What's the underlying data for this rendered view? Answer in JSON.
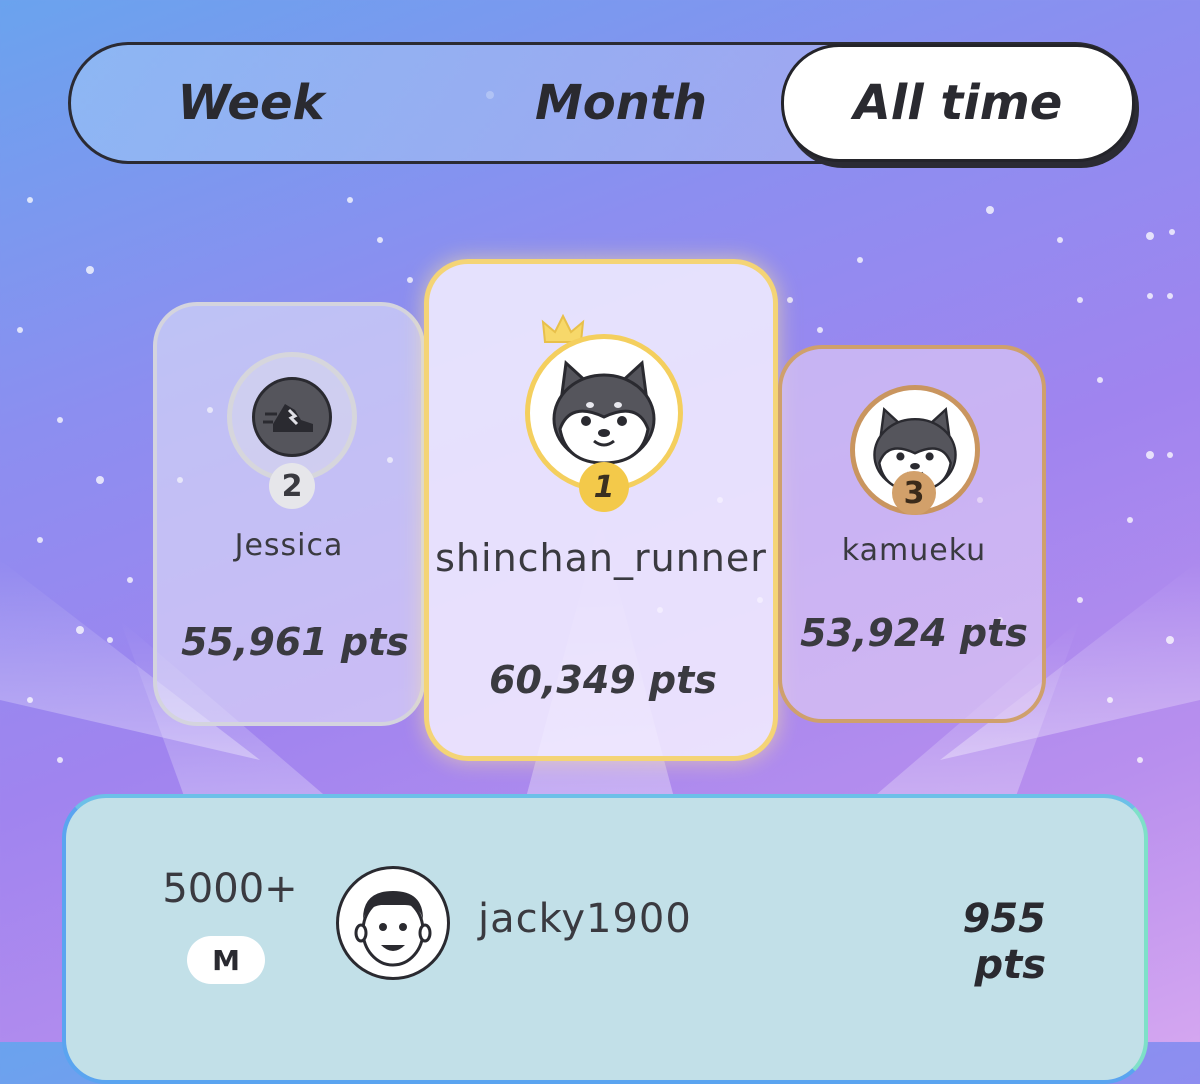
{
  "tabs": {
    "week": "Week",
    "month": "Month",
    "all_time": "All time",
    "selected": "All time"
  },
  "podium": {
    "first": {
      "rank": "1",
      "name": "shinchan_runner",
      "points": "60,349 pts",
      "avatar_icon": "shiba-dog-icon",
      "ring_color": "#f4cf5e"
    },
    "second": {
      "rank": "2",
      "name": "Jessica",
      "points": "55,961 pts",
      "avatar_icon": "running-shoe-icon",
      "ring_color": "#d6d6dc"
    },
    "third": {
      "rank": "3",
      "name": "kamueku",
      "points": "53,924 pts",
      "avatar_icon": "shiba-dog-icon",
      "ring_color": "#c9955f"
    }
  },
  "me": {
    "rank": "5000+",
    "level": "M",
    "name": "jacky1900",
    "points": "955 pts",
    "avatar_icon": "smiling-face-icon"
  }
}
